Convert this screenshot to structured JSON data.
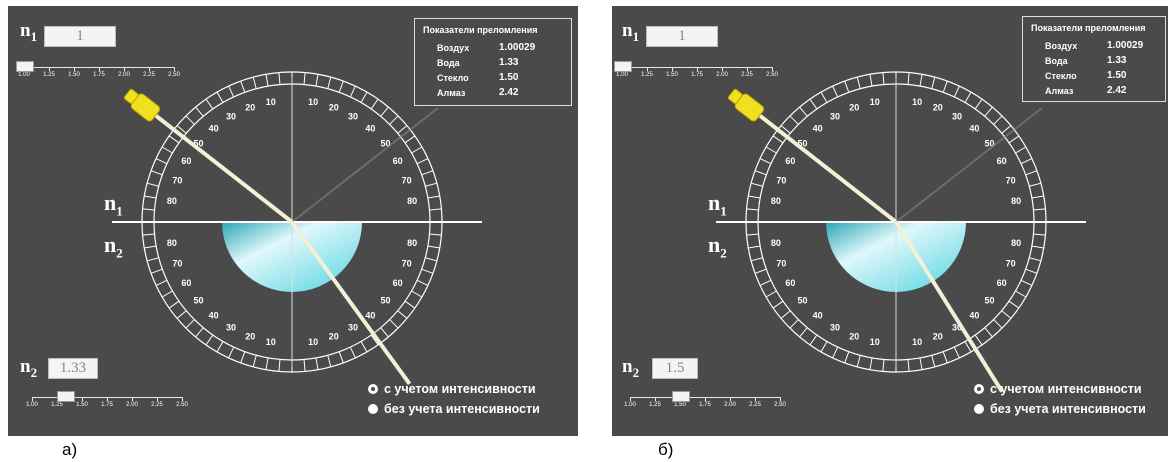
{
  "panels": [
    {
      "id": "a",
      "n1_symbol": "n",
      "n1_sub": "1",
      "n2_symbol": "n",
      "n2_sub": "2",
      "n1_value": "1",
      "n2_value": "1.33",
      "n1_fraction": 0.0,
      "n2_fraction": 0.22,
      "slider_ticks": [
        "1.00",
        "1.25",
        "1.50",
        "1.75",
        "2.00",
        "2.25",
        "2.50"
      ],
      "incident_angle_deg": 52,
      "refracted_angle_deg": 36,
      "dial_numbers": [
        "10",
        "20",
        "30",
        "40",
        "50",
        "60",
        "70",
        "80"
      ],
      "legend": {
        "title": "Показатели преломления",
        "rows": [
          {
            "name": "Воздух",
            "value": "1.00029"
          },
          {
            "name": "Вода",
            "value": "1.33"
          },
          {
            "name": "Стекло",
            "value": "1.50"
          },
          {
            "name": "Алмаз",
            "value": "2.42"
          }
        ]
      },
      "options": [
        {
          "label": "с учетом интенсивности",
          "selected": true
        },
        {
          "label": "без учета интенсивности",
          "selected": false
        }
      ],
      "caption": "а)"
    },
    {
      "id": "b",
      "n1_symbol": "n",
      "n1_sub": "1",
      "n2_symbol": "n",
      "n2_sub": "2",
      "n1_value": "1",
      "n2_value": "1.5",
      "n1_fraction": 0.0,
      "n2_fraction": 0.33,
      "slider_ticks": [
        "1.00",
        "1.25",
        "1.50",
        "1.75",
        "2.00",
        "2.25",
        "2.50"
      ],
      "incident_angle_deg": 52,
      "refracted_angle_deg": 32,
      "dial_numbers": [
        "10",
        "20",
        "30",
        "40",
        "50",
        "60",
        "70",
        "80"
      ],
      "legend": {
        "title": "Показатели преломления",
        "rows": [
          {
            "name": "Воздух",
            "value": "1.00029"
          },
          {
            "name": "Вода",
            "value": "1.33"
          },
          {
            "name": "Стекло",
            "value": "1.50"
          },
          {
            "name": "Алмаз",
            "value": "2.42"
          }
        ]
      },
      "options": [
        {
          "label": "с учетом интенсивности",
          "selected": true
        },
        {
          "label": "без учета интенсивности",
          "selected": false
        }
      ],
      "caption": "б)"
    }
  ],
  "colors": {
    "background": "#4a4a4a",
    "prism": "#4fd3df",
    "laser": "#f0e020",
    "beam": "#f4f0d8"
  },
  "icons": [
    "laser-pointer-icon",
    "protractor-dial-icon",
    "radio-button-icon"
  ]
}
